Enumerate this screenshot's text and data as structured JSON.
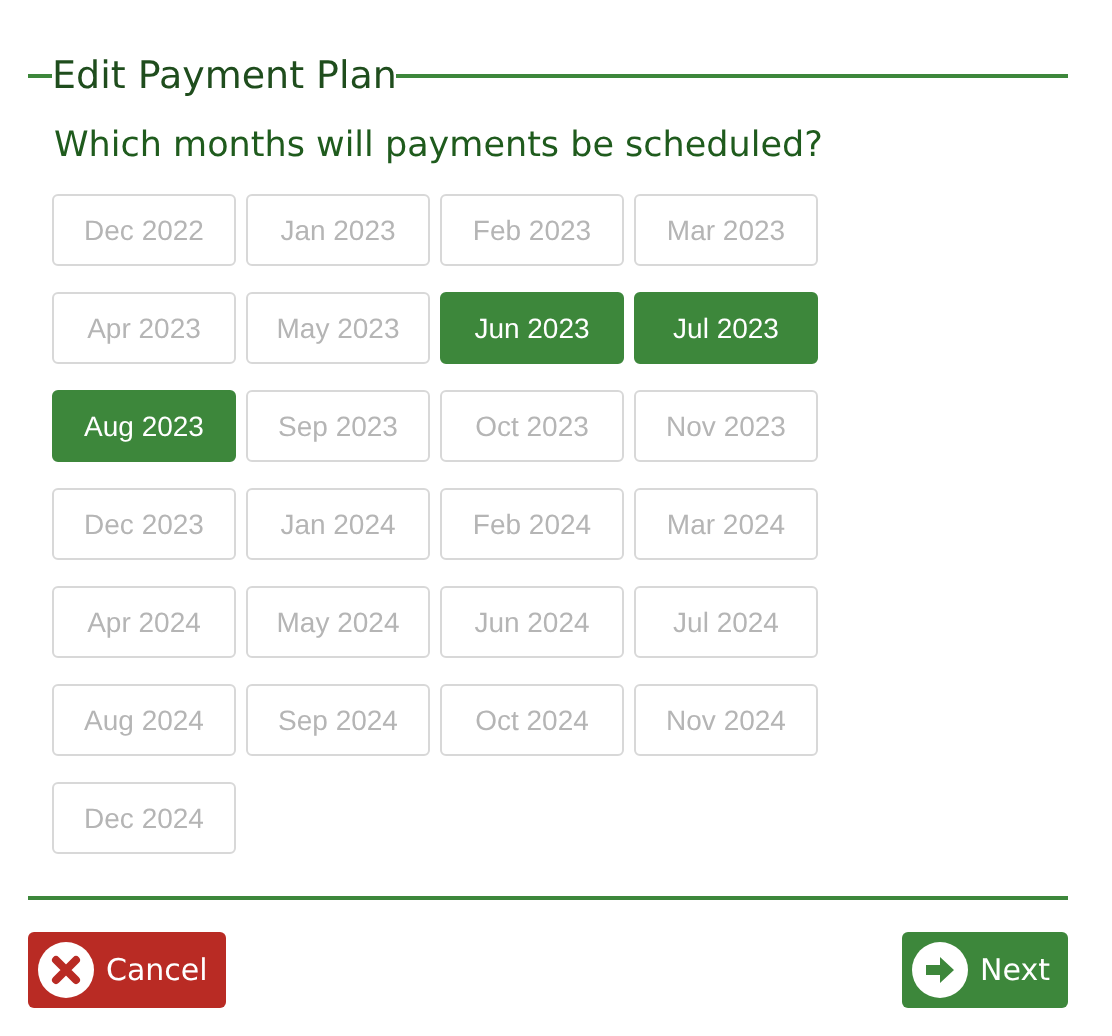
{
  "title": "Edit Payment Plan",
  "question": "Which months will payments be scheduled?",
  "months": [
    {
      "label": "Dec 2022",
      "selected": false
    },
    {
      "label": "Jan 2023",
      "selected": false
    },
    {
      "label": "Feb 2023",
      "selected": false
    },
    {
      "label": "Mar 2023",
      "selected": false
    },
    {
      "label": "Apr 2023",
      "selected": false
    },
    {
      "label": "May 2023",
      "selected": false
    },
    {
      "label": "Jun 2023",
      "selected": true
    },
    {
      "label": "Jul 2023",
      "selected": true
    },
    {
      "label": "Aug 2023",
      "selected": true
    },
    {
      "label": "Sep 2023",
      "selected": false
    },
    {
      "label": "Oct 2023",
      "selected": false
    },
    {
      "label": "Nov 2023",
      "selected": false
    },
    {
      "label": "Dec 2023",
      "selected": false
    },
    {
      "label": "Jan 2024",
      "selected": false
    },
    {
      "label": "Feb 2024",
      "selected": false
    },
    {
      "label": "Mar 2024",
      "selected": false
    },
    {
      "label": "Apr 2024",
      "selected": false
    },
    {
      "label": "May 2024",
      "selected": false
    },
    {
      "label": "Jun 2024",
      "selected": false
    },
    {
      "label": "Jul 2024",
      "selected": false
    },
    {
      "label": "Aug 2024",
      "selected": false
    },
    {
      "label": "Sep 2024",
      "selected": false
    },
    {
      "label": "Oct 2024",
      "selected": false
    },
    {
      "label": "Nov 2024",
      "selected": false
    },
    {
      "label": "Dec 2024",
      "selected": false
    }
  ],
  "actions": [
    {
      "kind": "cancel",
      "label": "Cancel"
    },
    {
      "kind": "next",
      "label": "Next"
    }
  ]
}
